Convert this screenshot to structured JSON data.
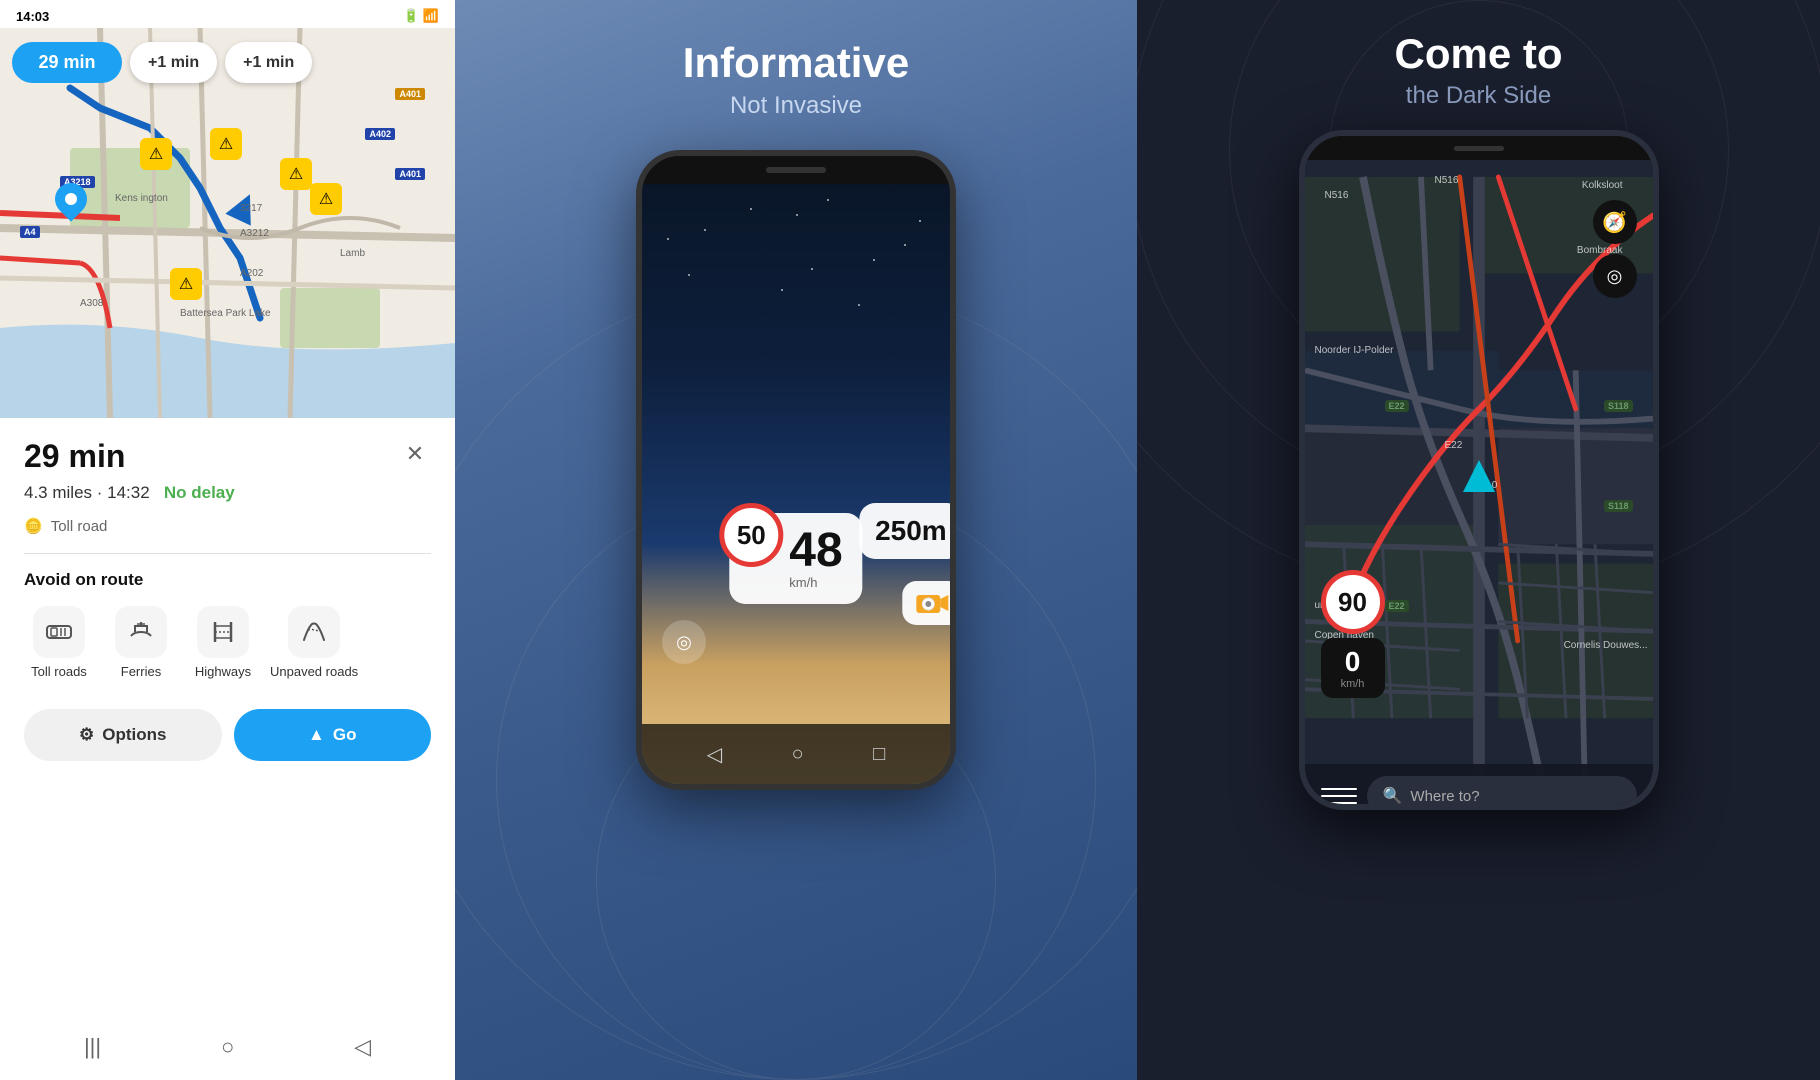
{
  "panel1": {
    "status_bar": {
      "time": "14:03",
      "icons": "signal"
    },
    "route_buttons": {
      "primary": "29 min",
      "secondary1": "+1 min",
      "secondary2": "+1 min"
    },
    "route_info": {
      "time": "29 min",
      "distance": "4.3 miles · 14:32",
      "delay": "No delay",
      "toll_label": "Toll road"
    },
    "avoid_section": {
      "title": "Avoid on route",
      "options": [
        {
          "icon": "🪙",
          "label": "Toll roads"
        },
        {
          "icon": "⛴",
          "label": "Ferries"
        },
        {
          "icon": "🛣",
          "label": "Highways"
        },
        {
          "icon": "〰",
          "label": "Unpaved roads"
        }
      ]
    },
    "action_buttons": {
      "options": "Options",
      "go": "Go"
    },
    "nav_bar": {
      "back": "◁",
      "home": "○",
      "menu": "|||"
    }
  },
  "panel2": {
    "title": "Informative",
    "subtitle": "Not Invasive",
    "speed_limit": "50",
    "speed_current": "48",
    "speed_unit": "km/h",
    "distance": "250m",
    "phone_nav": {
      "back": "◁",
      "home": "○",
      "recent": "□"
    }
  },
  "panel3": {
    "title": "Come to",
    "subtitle": "the Dark Side",
    "map_labels": {
      "n516": "N516",
      "kolksloot": "Kolksloot",
      "bombraak": "Bombraak",
      "noorder": "Noorder IJ-Polder",
      "e22": "E22",
      "a10": "A10",
      "copen": "Copen haven",
      "umhaven": "umhaven",
      "cornelis": "Cornelis Douwes...",
      "s118": "S118"
    },
    "speed_limit": "90",
    "speed_current": "0",
    "speed_unit": "km/h",
    "where_to": "Where to?",
    "bottom_bar": {
      "hamburger": "≡"
    }
  }
}
